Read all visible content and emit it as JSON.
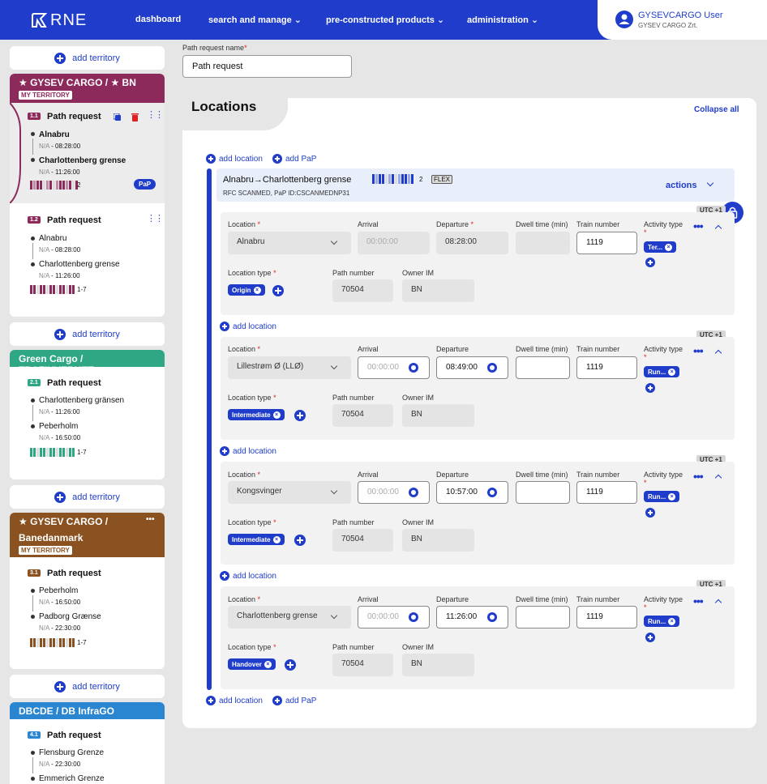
{
  "header": {
    "logo": "RNE",
    "nav": [
      "dashboard",
      "search and manage",
      "pre-constructed products",
      "administration"
    ],
    "user_name": "GYSEVCARGO User",
    "user_org": "GYSEV CARGO Zrt."
  },
  "sidebar": {
    "add_territory": "add territory",
    "territories": [
      {
        "name": "★ GYSEV CARGO / ★ BN",
        "badge": "MY TERRITORY",
        "color": "#8c2a5c",
        "requests": [
          {
            "num": "1.1",
            "title": "Path request",
            "from": "Alnabru",
            "from_time": "08:28:00",
            "to": "Charlottenberg grense",
            "to_time": "11:26:00",
            "count": "2",
            "pap": "PaP"
          },
          {
            "num": "1.2",
            "title": "Path request",
            "from": "Alnabru",
            "from_time": "08:28:00",
            "to": "Charlottenberg grense",
            "to_time": "11:26:00",
            "count": "1-7"
          }
        ]
      },
      {
        "name": "Green Cargo / TRAFIKVERKET",
        "color": "#2fa784",
        "requests": [
          {
            "num": "2.1",
            "title": "Path request",
            "from": "Charlottenberg gränsen",
            "from_time": "11:26:00",
            "to": "Peberholm",
            "to_time": "16:50:00",
            "count": "1-7"
          }
        ]
      },
      {
        "name": "★ GYSEV CARGO /",
        "name2": "Banedanmark",
        "badge": "MY TERRITORY",
        "color": "#8a5220",
        "more": "•••",
        "requests": [
          {
            "num": "3.1",
            "title": "Path request",
            "from": "Peberholm",
            "from_time": "16:50:00",
            "to": "Padborg Grænse",
            "to_time": "22:30:00",
            "count": "1-7"
          }
        ]
      },
      {
        "name": "DBCDE / DB InfraGO",
        "color": "#2b86d1",
        "requests": [
          {
            "num": "4.1",
            "title": "Path request",
            "from": "Flensburg Grenze",
            "from_time": "22:30:00",
            "to": "Emmerich Grenze"
          }
        ]
      }
    ],
    "na": "N/A"
  },
  "form": {
    "path_request_label": "Path request name",
    "path_request_value": "Path request"
  },
  "locations": {
    "title": "Locations",
    "collapse_all": "Collapse all",
    "add_location": "add location",
    "add_pap": "add PaP",
    "route_title": "Alnabru→Charlottenberg grense",
    "route_count": "2",
    "route_flex": "FLEX",
    "route_sub": "RFC SCANMED, PaP ID:CSCANMEDNP31",
    "actions": "actions",
    "labels": {
      "location": "Location",
      "arrival": "Arrival",
      "departure": "Departure",
      "dwell": "Dwell time (min)",
      "train": "Train number",
      "activity": "Activity type",
      "loc_type": "Location type",
      "path_number": "Path number",
      "owner": "Owner IM"
    },
    "arrival_placeholder": "00:00:00",
    "utc": "UTC +1",
    "rows": [
      {
        "location": "Alnabru",
        "arrival": "00:00:00",
        "departure": "08:28:00",
        "train": "1119",
        "activity": "Ter...",
        "loc_type": "Origin",
        "path_number": "70504",
        "owner": "BN"
      },
      {
        "location": "Lillestrøm Ø (LLØ)",
        "arrival": "",
        "departure": "08:49:00",
        "train": "1119",
        "activity": "Run...",
        "loc_type": "Intermediate",
        "path_number": "70504",
        "owner": "BN"
      },
      {
        "location": "Kongsvinger",
        "arrival": "",
        "departure": "10:57:00",
        "train": "1119",
        "activity": "Run...",
        "loc_type": "Intermediate",
        "path_number": "70504",
        "owner": "BN"
      },
      {
        "location": "Charlottenberg grense",
        "arrival": "",
        "departure": "11:26:00",
        "train": "1119",
        "activity": "Run...",
        "loc_type": "Handover",
        "path_number": "70504",
        "owner": "BN"
      }
    ]
  }
}
